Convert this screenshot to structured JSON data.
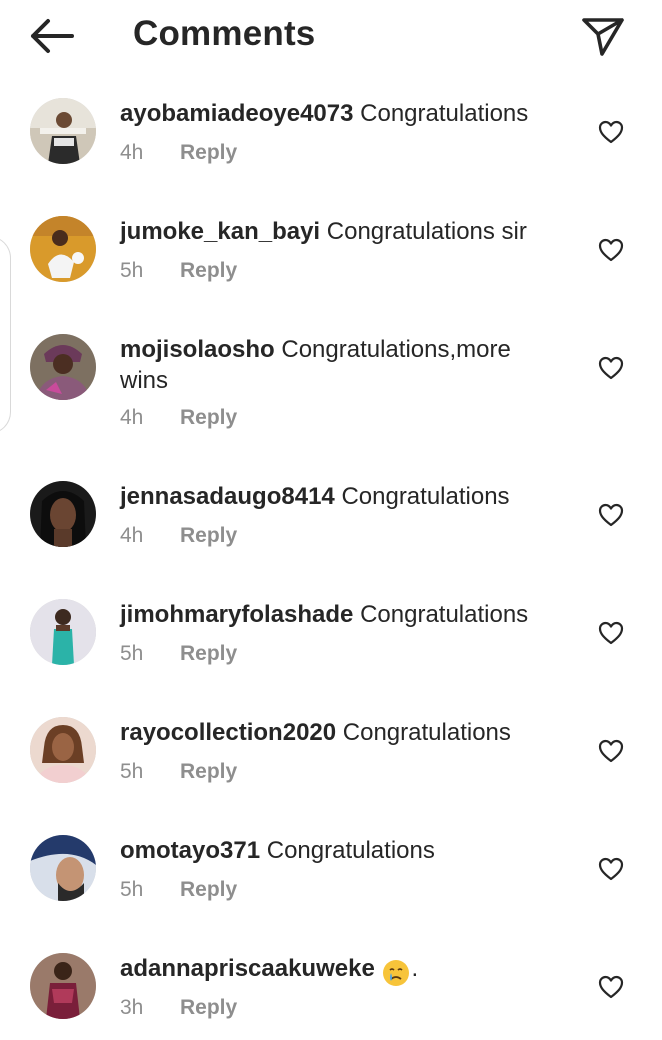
{
  "header": {
    "title": "Comments",
    "back_icon": "arrow-left-icon",
    "send_icon": "paper-plane-icon"
  },
  "reply_label": "Reply",
  "comments": [
    {
      "username": "ayobamiadeoye4073",
      "text": "Congratulations",
      "time": "4h"
    },
    {
      "username": "jumoke_kan_bayi",
      "text": "Congratulations sir",
      "time": "5h"
    },
    {
      "username": "mojisolaosho",
      "text": "Congratulations,more wins",
      "time": "4h"
    },
    {
      "username": "jennasadaugo8414",
      "text": "Congratulations",
      "time": "4h"
    },
    {
      "username": "jimohmaryfolashade",
      "text": "Congratulations",
      "time": "5h"
    },
    {
      "username": "rayocollection2020",
      "text": "Congratulations",
      "time": "5h"
    },
    {
      "username": "omotayo371",
      "text": "Congratulations",
      "time": "5h"
    },
    {
      "username": "adannapriscaakuweke",
      "text": ".",
      "time": "3h",
      "emoji": "crying-face-emoji"
    }
  ],
  "colors": {
    "text": "#262626",
    "secondary": "#8e8e8e",
    "background": "#ffffff"
  }
}
